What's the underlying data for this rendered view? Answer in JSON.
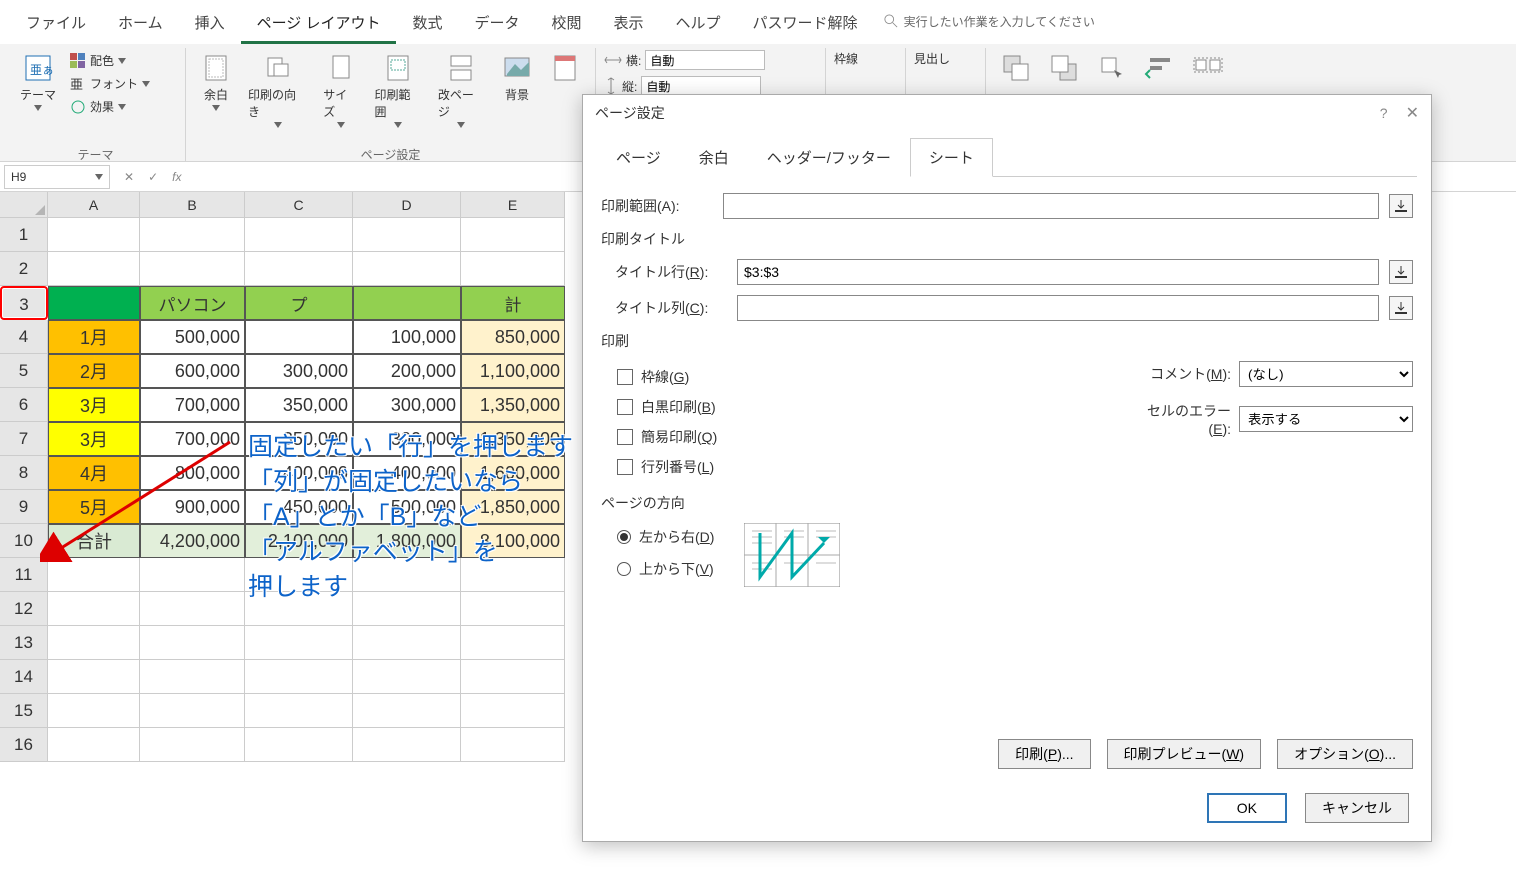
{
  "ribbon_tabs": [
    "ファイル",
    "ホーム",
    "挿入",
    "ページ レイアウト",
    "数式",
    "データ",
    "校閲",
    "表示",
    "ヘルプ",
    "パスワード解除"
  ],
  "active_tab": "ページ レイアウト",
  "tellme_placeholder": "実行したい作業を入力してください",
  "ribbon": {
    "theme_group": "テーマ",
    "theme": "テーマ",
    "colors": "配色",
    "fonts": "フォント",
    "effects": "効果",
    "pagesetup_group": "ページ設定",
    "margins": "余白",
    "orientation": "印刷の向き",
    "size": "サイズ",
    "printarea": "印刷範囲",
    "breaks": "改ページ",
    "background": "背景",
    "width_lbl": "横:",
    "height_lbl": "縦:",
    "auto": "自動",
    "gridlines": "枠線",
    "headings": "見出し"
  },
  "name_box": "H9",
  "annotation_lines": [
    "固定したい「行」を押します",
    "「列」が固定したいなら",
    "「A」とか「B」など",
    "「アルファベット」を",
    "押します"
  ],
  "columns": [
    "A",
    "B",
    "C",
    "D",
    "E"
  ],
  "row_numbers": [
    "1",
    "2",
    "3",
    "4",
    "5",
    "6",
    "7",
    "8",
    "9",
    "10",
    "11",
    "12",
    "13",
    "14",
    "15",
    "16"
  ],
  "headers_row3": [
    "",
    "パソコン",
    "プ",
    "",
    "計"
  ],
  "data_rows": [
    {
      "m": "1月",
      "mcls": "",
      "b": "500,000",
      "c": "",
      "d": "100,000",
      "e": "850,000"
    },
    {
      "m": "2月",
      "mcls": "",
      "b": "600,000",
      "c": "300,000",
      "d": "200,000",
      "e": "1,100,000"
    },
    {
      "m": "3月",
      "mcls": "y",
      "b": "700,000",
      "c": "350,000",
      "d": "300,000",
      "e": "1,350,000"
    },
    {
      "m": "3月",
      "mcls": "y",
      "b": "700,000",
      "c": "350,000",
      "d": "300,000",
      "e": "1,350,000"
    },
    {
      "m": "4月",
      "mcls": "",
      "b": "800,000",
      "c": "400,000",
      "d": "400,000",
      "e": "1,600,000"
    },
    {
      "m": "5月",
      "mcls": "",
      "b": "900,000",
      "c": "450,000",
      "d": "500,000",
      "e": "1,850,000"
    }
  ],
  "footer_row": {
    "a": "合計",
    "b": "4,200,000",
    "c": "2,100,000",
    "d": "1,800,000",
    "e": "8,100,000"
  },
  "dialog": {
    "title": "ページ設定",
    "tabs": [
      "ページ",
      "余白",
      "ヘッダー/フッター",
      "シート"
    ],
    "active": "シート",
    "print_area_lbl": "印刷範囲(A):",
    "print_area_val": "",
    "print_titles_section": "印刷タイトル",
    "title_row_lbl": "タイトル行(R):",
    "title_row_val": "$3:$3",
    "title_col_lbl": "タイトル列(C):",
    "title_col_val": "",
    "print_section": "印刷",
    "chk_gridlines": "枠線(G)",
    "chk_bw": "白黒印刷(B)",
    "chk_draft": "簡易印刷(Q)",
    "chk_rowcol": "行列番号(L)",
    "comments_lbl": "コメント(M):",
    "comments_val": "(なし)",
    "errors_lbl": "セルのエラー(E):",
    "errors_val": "表示する",
    "direction_section": "ページの方向",
    "dir_across": "左から右(D)",
    "dir_down": "上から下(V)",
    "btn_print": "印刷(P)...",
    "btn_preview": "印刷プレビュー(W)",
    "btn_options": "オプション(O)...",
    "ok": "OK",
    "cancel": "キャンセル"
  }
}
